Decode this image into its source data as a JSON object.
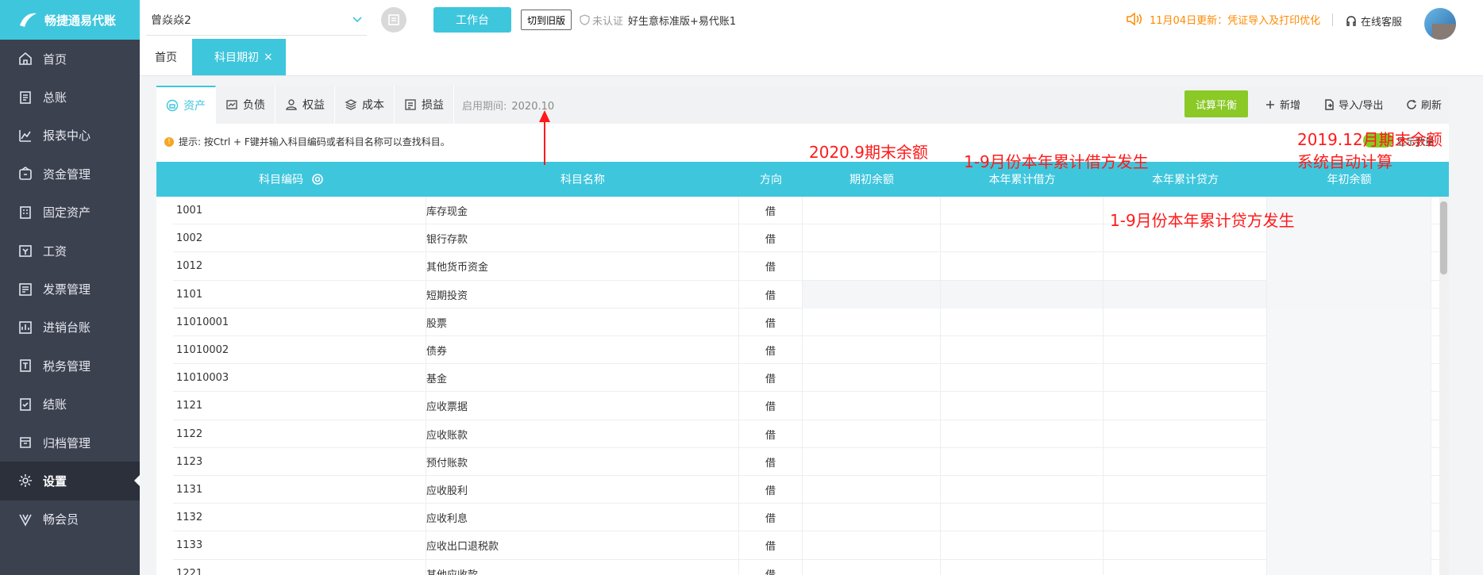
{
  "app": {
    "logo_text": "畅捷通易代账"
  },
  "topbar": {
    "company": "曾焱焱2",
    "workbench_label": "工作台",
    "switch_old_label": "切到旧版",
    "cert_status": "未认证",
    "edition": "好生意标准版+易代账1",
    "notice": "11月04日更新：凭证导入及打印优化",
    "service_label": "在线客服"
  },
  "sidebar": {
    "items": [
      {
        "label": "首页",
        "icon": "home-icon"
      },
      {
        "label": "总账",
        "icon": "ledger-icon"
      },
      {
        "label": "报表中心",
        "icon": "chart-icon"
      },
      {
        "label": "资金管理",
        "icon": "wallet-icon"
      },
      {
        "label": "固定资产",
        "icon": "building-icon"
      },
      {
        "label": "工资",
        "icon": "salary-icon"
      },
      {
        "label": "发票管理",
        "icon": "invoice-icon"
      },
      {
        "label": "进销台账",
        "icon": "inventory-icon"
      },
      {
        "label": "税务管理",
        "icon": "tax-icon"
      },
      {
        "label": "结账",
        "icon": "closing-icon"
      },
      {
        "label": "归档管理",
        "icon": "archive-icon"
      },
      {
        "label": "设置",
        "icon": "gear-icon",
        "active": true
      },
      {
        "label": "畅会员",
        "icon": "vip-icon"
      }
    ]
  },
  "page_tabs": [
    {
      "label": "首页"
    },
    {
      "label": "科目期初",
      "close": "×",
      "active": true
    }
  ],
  "subtabs": [
    {
      "label": "资产",
      "icon": "asset-icon",
      "active": true
    },
    {
      "label": "负债",
      "icon": "liability-icon"
    },
    {
      "label": "权益",
      "icon": "equity-icon"
    },
    {
      "label": "成本",
      "icon": "cost-icon"
    },
    {
      "label": "损益",
      "icon": "profit-loss-icon"
    }
  ],
  "period": {
    "label": "启用期间:",
    "value": "2020.10"
  },
  "toolbar": {
    "trial_balance": "试算平衡",
    "add": "新增",
    "import_export": "导入/导出",
    "refresh": "刷新"
  },
  "hint": "提示: 按Ctrl + F键并输入科目编码或者科目名称可以查找科目。",
  "toggle_label": "显示数量",
  "table": {
    "headers": [
      "科目编码",
      "科目名称",
      "方向",
      "期初余额",
      "本年累计借方",
      "本年累计贷方",
      "年初余额"
    ],
    "rows": [
      {
        "code": "1001",
        "name": "库存现金",
        "dir": "借"
      },
      {
        "code": "1002",
        "name": "银行存款",
        "dir": "借"
      },
      {
        "code": "1012",
        "name": "其他货币资金",
        "dir": "借"
      },
      {
        "code": "1101",
        "name": "短期投资",
        "dir": "借",
        "shaded": true
      },
      {
        "code": "11010001",
        "name": "股票",
        "dir": "借"
      },
      {
        "code": "11010002",
        "name": "债券",
        "dir": "借"
      },
      {
        "code": "11010003",
        "name": "基金",
        "dir": "借"
      },
      {
        "code": "1121",
        "name": "应收票据",
        "dir": "借"
      },
      {
        "code": "1122",
        "name": "应收账款",
        "dir": "借"
      },
      {
        "code": "1123",
        "name": "预付账款",
        "dir": "借"
      },
      {
        "code": "1131",
        "name": "应收股利",
        "dir": "借"
      },
      {
        "code": "1132",
        "name": "应收利息",
        "dir": "借"
      },
      {
        "code": "1133",
        "name": "应收出口退税款",
        "dir": "借"
      },
      {
        "code": "1221",
        "name": "其他应收款",
        "dir": "借"
      }
    ]
  },
  "annotations": {
    "opening": "2020.9期末余额",
    "debit": "1-9月份本年累计借方发生",
    "credit": "1-9月份本年累计贷方发生",
    "year_line1": "2019.12月期末余额",
    "year_line2": "系统自动计算"
  }
}
